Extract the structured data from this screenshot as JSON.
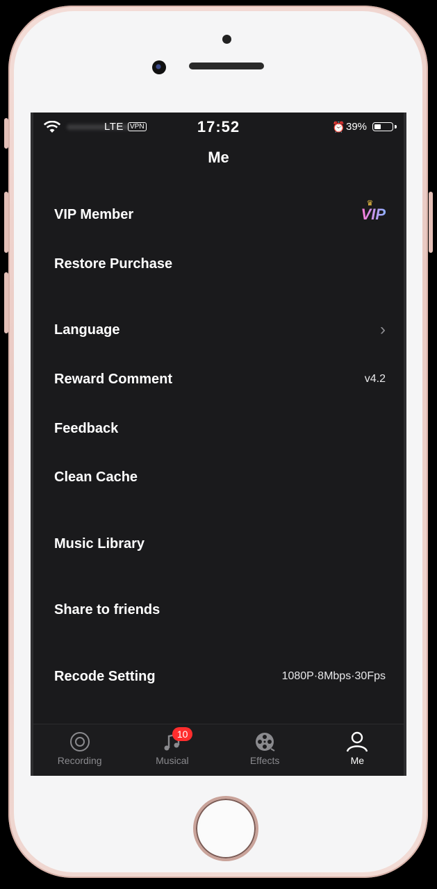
{
  "status": {
    "carrier": "LTE",
    "vpn": "VPN",
    "time": "17:52",
    "battery": "39%",
    "battery_level": 0.39,
    "icons": [
      "wifi-icon",
      "alarm-icon",
      "battery-icon"
    ]
  },
  "header": {
    "title": "Me"
  },
  "menu": {
    "vip": {
      "label": "VIP Member",
      "badge": "VIP"
    },
    "restore": {
      "label": "Restore Purchase"
    },
    "language": {
      "label": "Language"
    },
    "reward": {
      "label": "Reward Comment",
      "value": "v4.2"
    },
    "feedback": {
      "label": "Feedback"
    },
    "cache": {
      "label": "Clean Cache"
    },
    "music": {
      "label": "Music Library"
    },
    "share": {
      "label": "Share to friends"
    },
    "recode": {
      "label": "Recode Setting",
      "value": "1080P·8Mbps·30Fps"
    }
  },
  "tabs": [
    {
      "label": "Recording",
      "icon": "record-icon"
    },
    {
      "label": "Musical",
      "icon": "music-note-icon",
      "badge": "10"
    },
    {
      "label": "Effects",
      "icon": "film-reel-icon"
    },
    {
      "label": "Me",
      "icon": "person-icon",
      "active": true
    }
  ],
  "colors": {
    "background": "#1a1a1c",
    "badge": "#ff2d2d",
    "tab_inactive": "#8a8a8e",
    "tab_active": "#ffffff"
  }
}
